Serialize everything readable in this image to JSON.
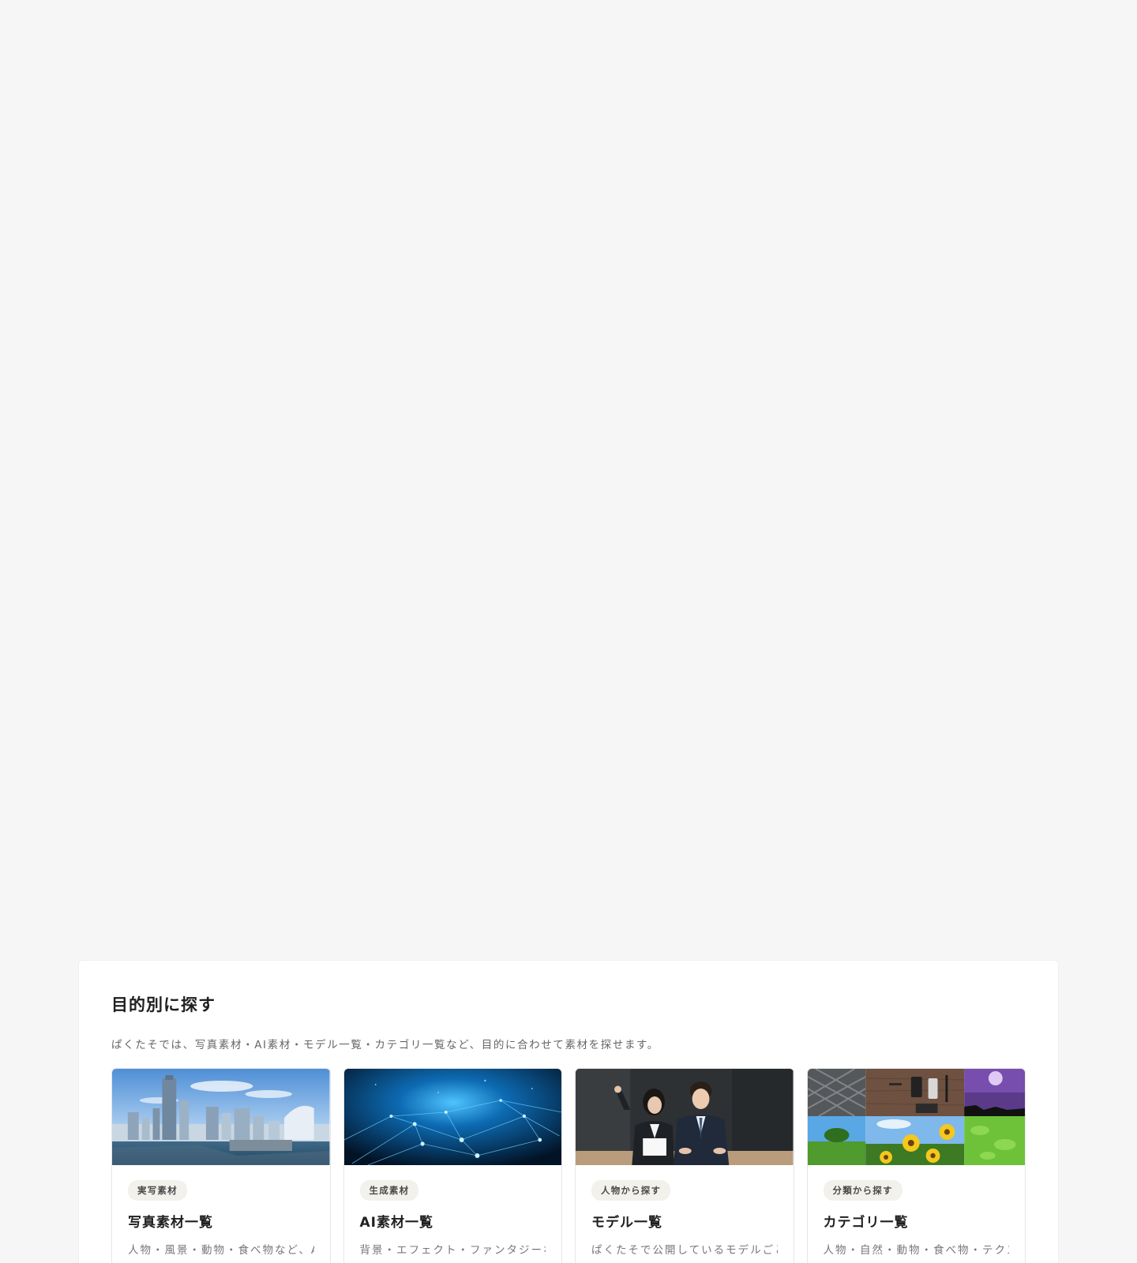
{
  "section": {
    "title": "目的別に探す",
    "description": "ぱくたそでは、写真素材・AI素材・モデル一覧・カテゴリ一覧など、目的に合わせて素材を探せます。"
  },
  "cards": [
    {
      "tag": "実写素材",
      "title": "写真素材一覧",
      "description": "人物・風景・動物・食べ物など、AI",
      "image": "city-skyline-photo"
    },
    {
      "tag": "生成素材",
      "title": "AI素材一覧",
      "description": "背景・エフェクト・ファンタジーな",
      "image": "blue-network-photo"
    },
    {
      "tag": "人物から探す",
      "title": "モデル一覧",
      "description": "ぱくたそで公開しているモデルごと",
      "image": "business-people-photo"
    },
    {
      "tag": "分類から探す",
      "title": "カテゴリ一覧",
      "description": "人物・自然・動物・食べ物・テクス",
      "image": "category-collage-photo"
    }
  ]
}
